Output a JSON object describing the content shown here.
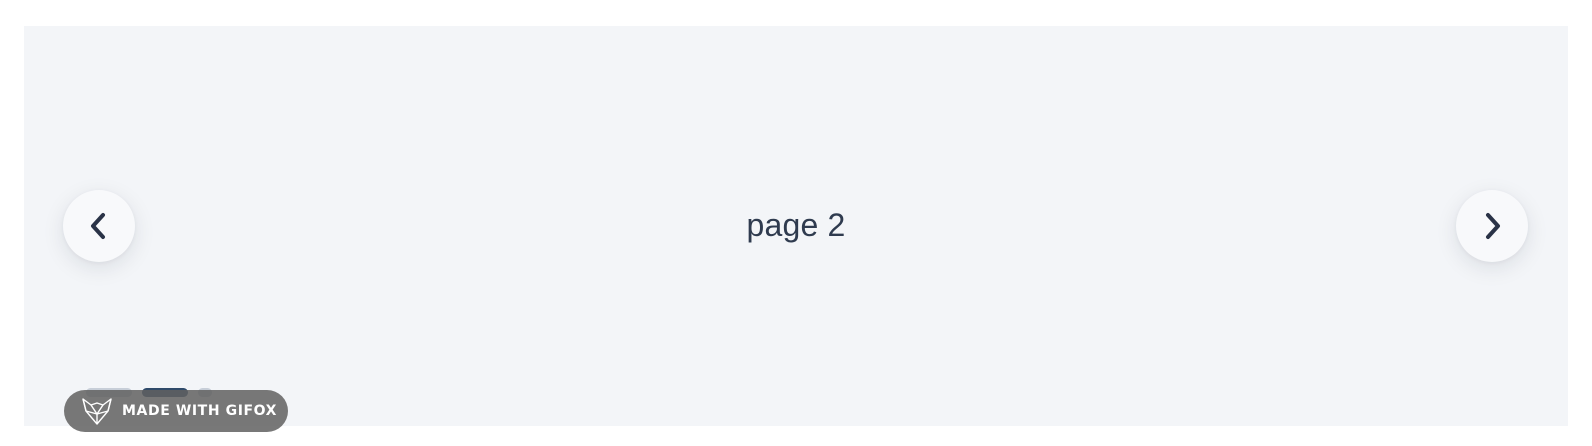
{
  "slide": {
    "text": "page 2"
  },
  "navigation": {
    "prev_icon": "chevron-left-icon",
    "next_icon": "chevron-right-icon",
    "icon_color": "#2a3347"
  },
  "indicators": {
    "count": 3,
    "active_index": 1
  },
  "watermark": {
    "logo_icon": "fox-logo-icon",
    "label": "MADE WITH GIFOX"
  },
  "colors": {
    "slide_background": "#f3f5f8",
    "text": "#2f3b4f",
    "badge_background": "#606060"
  }
}
